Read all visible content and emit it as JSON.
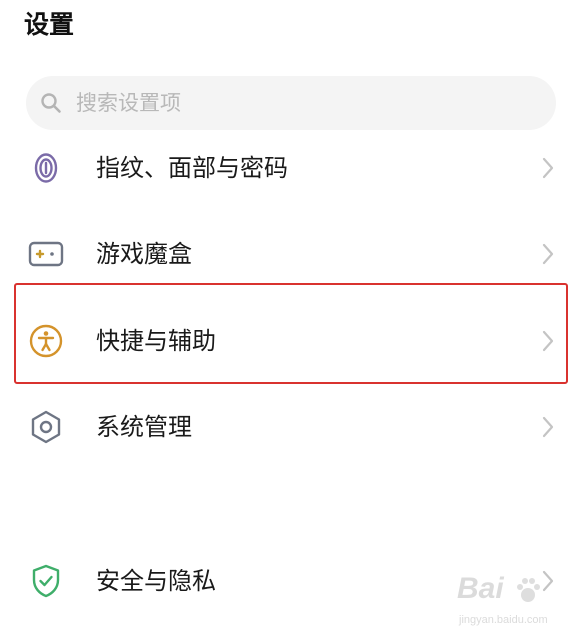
{
  "header": {
    "title": "设置"
  },
  "search": {
    "placeholder": "搜索设置项"
  },
  "items": [
    {
      "label": "指纹、面部与密码",
      "icon": "fingerprint-icon",
      "icon_color": "#7b6ba8"
    },
    {
      "label": "游戏魔盒",
      "icon": "game-box-icon",
      "icon_color": "#c79a2c"
    },
    {
      "label": "快捷与辅助",
      "icon": "accessibility-icon",
      "icon_color": "#d4932b",
      "highlighted": true
    },
    {
      "label": "系统管理",
      "icon": "system-hexagon-icon",
      "icon_color": "#6e7584"
    },
    {
      "label": "安全与隐私",
      "icon": "shield-check-icon",
      "icon_color": "#3fae6a"
    }
  ],
  "watermark": {
    "brand": "Bai",
    "site": "jingyan.baidu.com"
  },
  "colors": {
    "highlight_border": "#d9322f",
    "chevron": "#c4c4c4",
    "search_bg": "#f4f4f4"
  }
}
